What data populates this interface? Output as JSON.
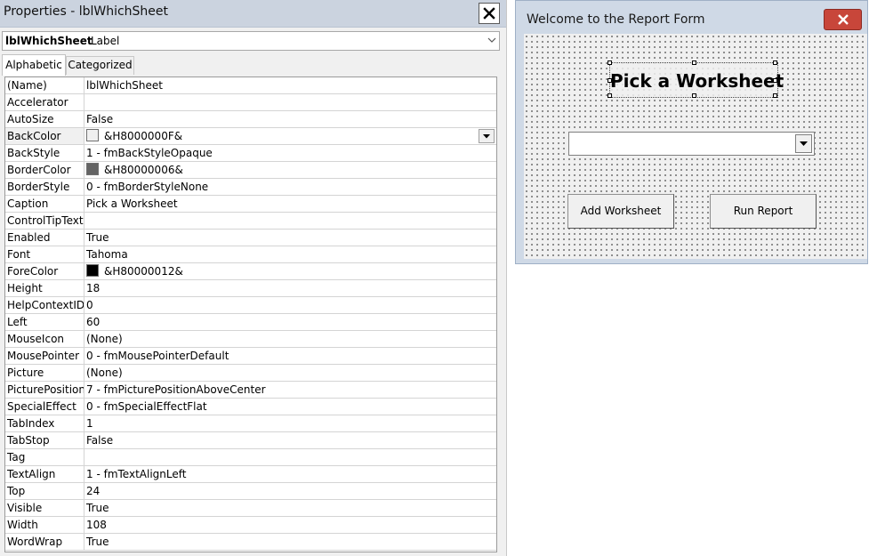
{
  "properties_window": {
    "title": "Properties - lblWhichSheet",
    "object_name": "lblWhichSheet",
    "object_type": "Label",
    "tabs": [
      {
        "label": "Alphabetic",
        "active": true
      },
      {
        "label": "Categorized",
        "active": false
      }
    ],
    "rows": [
      {
        "name": "(Name)",
        "value": "lblWhichSheet"
      },
      {
        "name": "Accelerator",
        "value": ""
      },
      {
        "name": "AutoSize",
        "value": "False"
      },
      {
        "name": "BackColor",
        "value": "&H8000000F&"
      },
      {
        "name": "BackStyle",
        "value": "1 - fmBackStyleOpaque"
      },
      {
        "name": "BorderColor",
        "value": "&H80000006&"
      },
      {
        "name": "BorderStyle",
        "value": "0 - fmBorderStyleNone"
      },
      {
        "name": "Caption",
        "value": "Pick a Worksheet"
      },
      {
        "name": "ControlTipText",
        "value": ""
      },
      {
        "name": "Enabled",
        "value": "True"
      },
      {
        "name": "Font",
        "value": "Tahoma"
      },
      {
        "name": "ForeColor",
        "value": "&H80000012&"
      },
      {
        "name": "Height",
        "value": "18"
      },
      {
        "name": "HelpContextID",
        "value": "0"
      },
      {
        "name": "Left",
        "value": "60"
      },
      {
        "name": "MouseIcon",
        "value": "(None)"
      },
      {
        "name": "MousePointer",
        "value": "0 - fmMousePointerDefault"
      },
      {
        "name": "Picture",
        "value": "(None)"
      },
      {
        "name": "PicturePosition",
        "value": "7 - fmPicturePositionAboveCenter"
      },
      {
        "name": "SpecialEffect",
        "value": "0 - fmSpecialEffectFlat"
      },
      {
        "name": "TabIndex",
        "value": "1"
      },
      {
        "name": "TabStop",
        "value": "False"
      },
      {
        "name": "Tag",
        "value": ""
      },
      {
        "name": "TextAlign",
        "value": "1 - fmTextAlignLeft"
      },
      {
        "name": "Top",
        "value": "24"
      },
      {
        "name": "Visible",
        "value": "True"
      },
      {
        "name": "Width",
        "value": "108"
      },
      {
        "name": "WordWrap",
        "value": "True"
      }
    ],
    "selected_row": "BackColor",
    "swatch_colors": {
      "BackColor": "#f0f0f0",
      "BorderColor": "#646464",
      "ForeColor": "#000000"
    }
  },
  "user_form": {
    "title": "Welcome to the Report Form",
    "label_caption": "Pick a Worksheet",
    "combo_value": "",
    "buttons": {
      "add": "Add Worksheet",
      "run": "Run Report"
    }
  },
  "colors": {
    "titlebar": "#cbd3df",
    "form_frame": "#cfd9e6",
    "close_red": "#c8463a",
    "grid_line": "#d4d4d4"
  }
}
